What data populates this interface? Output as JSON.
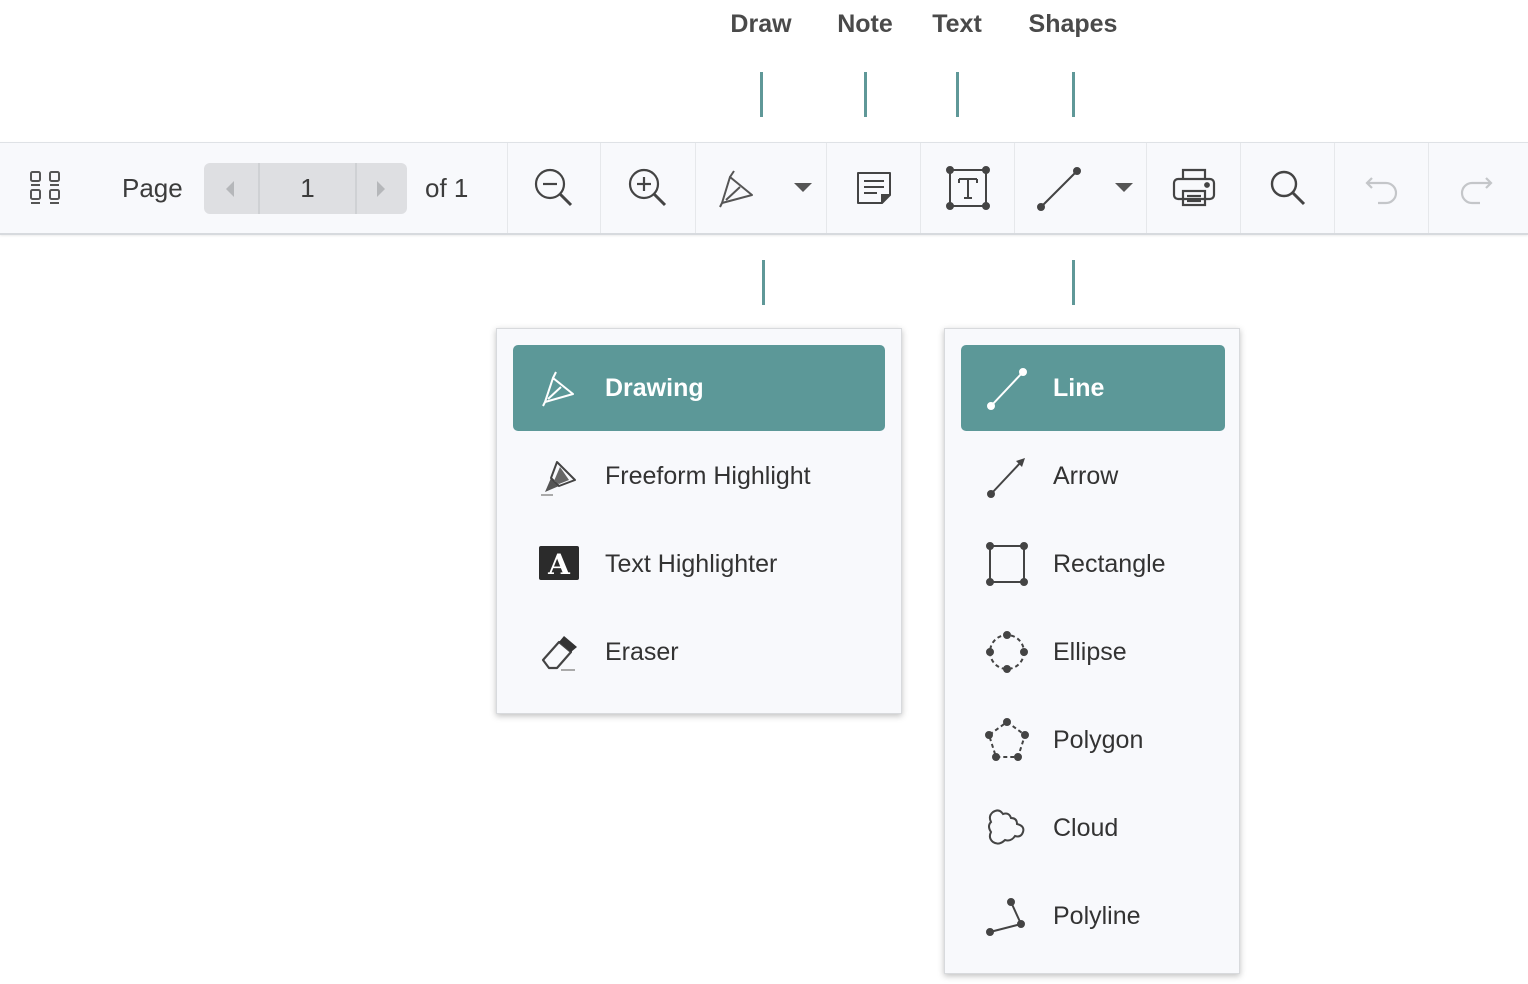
{
  "callouts": {
    "draw": "Draw",
    "note": "Note",
    "text": "Text",
    "shapes": "Shapes"
  },
  "toolbar": {
    "page_label": "Page",
    "page_value": "1",
    "of_total": "of 1",
    "icons": [
      "thumbnails-icon",
      "page-prev-icon",
      "page-next-icon",
      "zoom-out-icon",
      "zoom-in-icon",
      "draw-pen-icon",
      "dropdown-caret-icon",
      "note-icon",
      "text-box-icon",
      "line-shape-icon",
      "print-icon",
      "search-icon",
      "undo-icon",
      "redo-icon"
    ]
  },
  "draw_menu": {
    "items": [
      {
        "label": "Drawing",
        "icon": "pen-icon",
        "selected": true
      },
      {
        "label": "Freeform Highlight",
        "icon": "highlighter-icon",
        "selected": false
      },
      {
        "label": "Text Highlighter",
        "icon": "text-highlighter-icon",
        "selected": false
      },
      {
        "label": "Eraser",
        "icon": "eraser-icon",
        "selected": false
      }
    ]
  },
  "shapes_menu": {
    "items": [
      {
        "label": "Line",
        "icon": "line-icon",
        "selected": true
      },
      {
        "label": "Arrow",
        "icon": "arrow-icon",
        "selected": false
      },
      {
        "label": "Rectangle",
        "icon": "rectangle-icon",
        "selected": false
      },
      {
        "label": "Ellipse",
        "icon": "ellipse-icon",
        "selected": false
      },
      {
        "label": "Polygon",
        "icon": "polygon-icon",
        "selected": false
      },
      {
        "label": "Cloud",
        "icon": "cloud-icon",
        "selected": false
      },
      {
        "label": "Polyline",
        "icon": "polyline-icon",
        "selected": false
      }
    ]
  },
  "colors": {
    "accent": "#5c9898",
    "toolbar_bg": "#f8f9fc",
    "icon": "#444444",
    "icon_disabled": "#c4c6c9"
  }
}
